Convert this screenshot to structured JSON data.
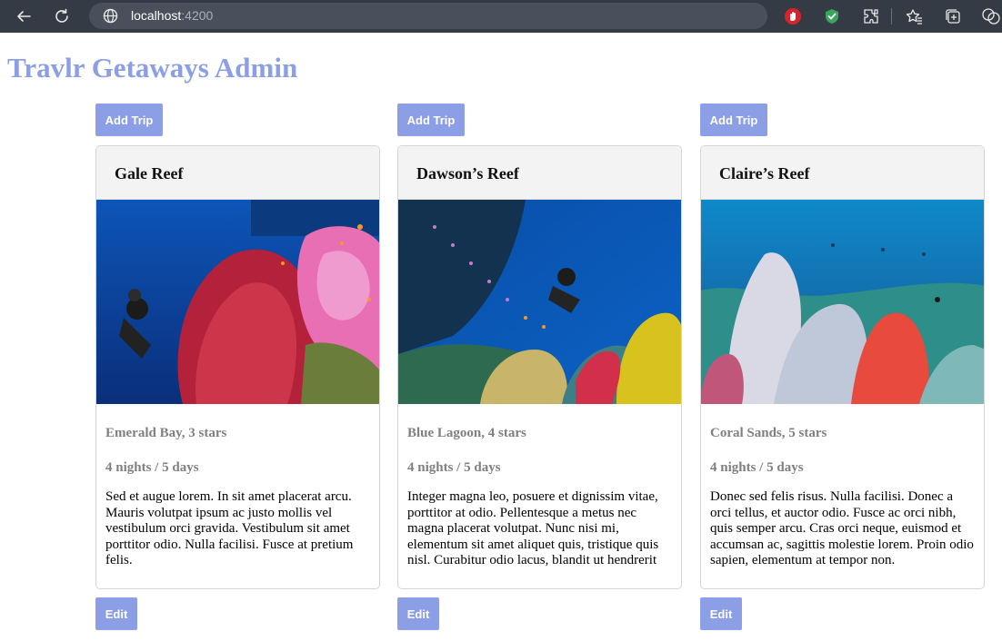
{
  "browser": {
    "url_host": "localhost",
    "url_port": ":4200",
    "icons": [
      "back-arrow-icon",
      "reload-icon",
      "site-info-icon",
      "adblock-icon",
      "shield-check-icon",
      "extensions-icon",
      "favorites-icon",
      "collections-icon",
      "copilot-icon"
    ]
  },
  "page": {
    "title": "Travlr Getaways Admin",
    "accent_color": "#8c9fe6"
  },
  "trips": [
    {
      "add_label": "Add Trip",
      "name": "Gale Reef",
      "resort": "Emerald Bay, 3 stars",
      "length": "4 nights / 5 days",
      "description": "Sed et augue lorem. In sit amet placerat arcu. Mauris volutpat ipsum ac justo mollis vel vestibulum orci gravida. Vestibulum sit amet porttitor odio. Nulla facilisi. Fusce at pretium felis.",
      "edit_label": "Edit"
    },
    {
      "add_label": "Add Trip",
      "name": "Dawson’s Reef",
      "resort": "Blue Lagoon, 4 stars",
      "length": "4 nights / 5 days",
      "description": "Integer magna leo, posuere et dignissim vitae, porttitor at odio. Pellentesque a metus nec magna placerat volutpat. Nunc nisi mi, elementum sit amet aliquet quis, tristique quis nisl. Curabitur odio lacus, blandit ut hendrerit",
      "edit_label": "Edit"
    },
    {
      "add_label": "Add Trip",
      "name": "Claire’s Reef",
      "resort": "Coral Sands, 5 stars",
      "length": "4 nights / 5 days",
      "description": "Donec sed felis risus. Nulla facilisi. Donec a orci tellus, et auctor odio. Fusce ac orci nibh, quis semper arcu. Cras orci neque, euismod et accumsan ac, sagittis molestie lorem. Proin odio sapien, elementum at tempor non.",
      "edit_label": "Edit"
    }
  ]
}
